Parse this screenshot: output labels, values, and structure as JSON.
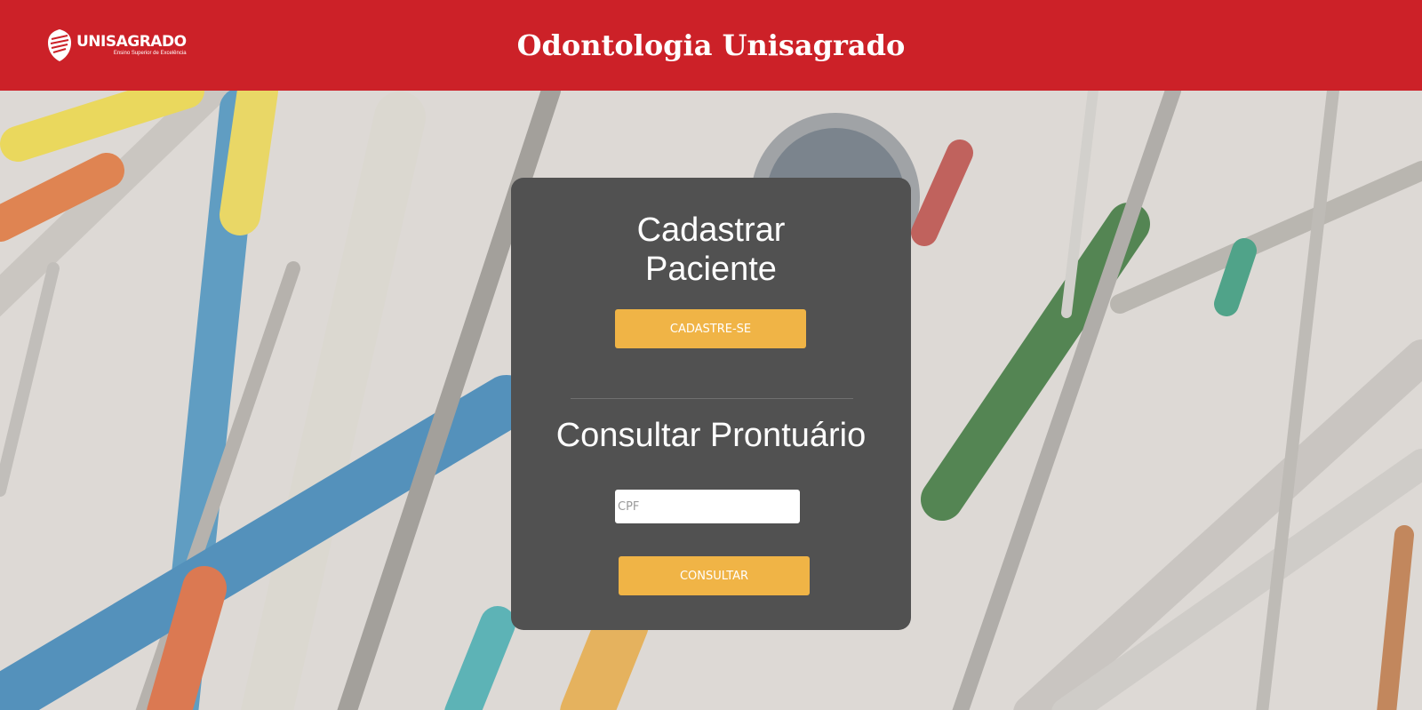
{
  "header": {
    "site_title": "Odontologia Unisagrado",
    "logo_name": "UNISAGRADO",
    "logo_tagline": "Ensino Superior de Excelência",
    "color": "#cc2128"
  },
  "register": {
    "title_line1": "Cadastrar",
    "title_line2": "Paciente",
    "button_label": "CADASTRE-SE"
  },
  "lookup": {
    "title": "Consultar Prontuário",
    "cpf_placeholder": "CPF",
    "cpf_value": "",
    "button_label": "CONSULTAR"
  },
  "colors": {
    "card": "#515151",
    "button": "#f0b446"
  },
  "background": {
    "subject": "dental-instruments-photo"
  }
}
